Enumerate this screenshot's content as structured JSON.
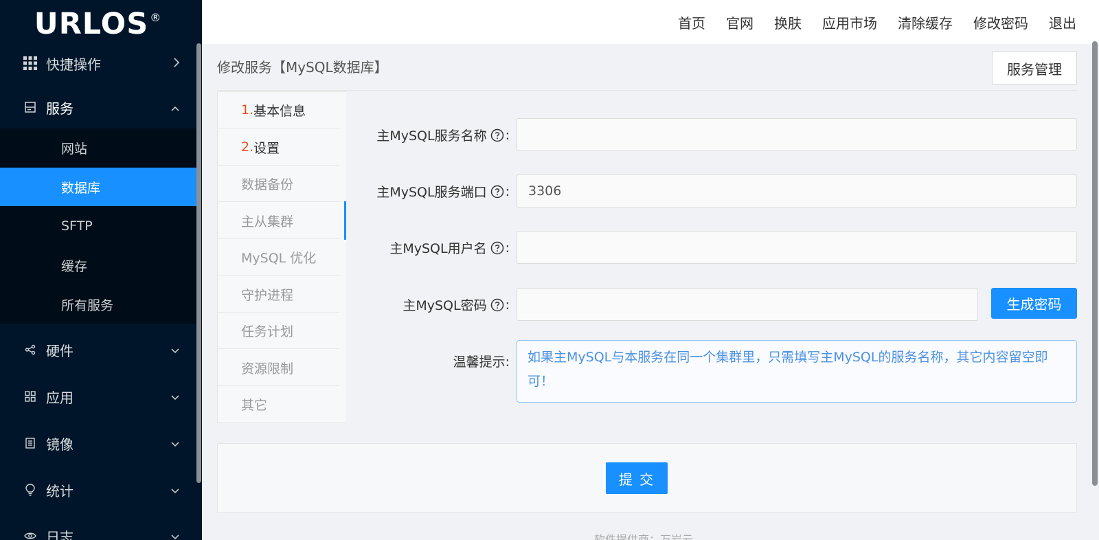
{
  "brand": {
    "name": "URLOS",
    "reg": "®"
  },
  "sidebar": {
    "menus": [
      {
        "label": "快捷操作",
        "icon": "grid-icon",
        "arrow": "right"
      },
      {
        "label": "服务",
        "icon": "server-icon",
        "arrow": "up"
      },
      {
        "label": "硬件",
        "icon": "share-icon",
        "arrow": "down"
      },
      {
        "label": "应用",
        "icon": "apps-icon",
        "arrow": "down"
      },
      {
        "label": "镜像",
        "icon": "image-icon",
        "arrow": "down"
      },
      {
        "label": "统计",
        "icon": "bulb-icon",
        "arrow": "down"
      },
      {
        "label": "日志",
        "icon": "eye-icon",
        "arrow": "down"
      }
    ],
    "service_items": [
      {
        "label": "网站"
      },
      {
        "label": "数据库",
        "active": true
      },
      {
        "label": "SFTP"
      },
      {
        "label": "缓存"
      },
      {
        "label": "所有服务"
      }
    ]
  },
  "topnav": [
    "首页",
    "官网",
    "换肤",
    "应用市场",
    "清除缓存",
    "修改密码",
    "退出"
  ],
  "page": {
    "title": "修改服务【MySQL数据库】",
    "manage_button": "服务管理"
  },
  "tabs": [
    {
      "num": "1.",
      "label": "基本信息"
    },
    {
      "num": "2.",
      "label": "设置"
    },
    {
      "label": "数据备份"
    },
    {
      "label": "主从集群"
    },
    {
      "label": "MySQL 优化"
    },
    {
      "label": "守护进程"
    },
    {
      "label": "任务计划"
    },
    {
      "label": "资源限制"
    },
    {
      "label": "其它"
    }
  ],
  "form": {
    "service_name": {
      "label": "主MySQL服务名称",
      "value": ""
    },
    "service_port": {
      "label": "主MySQL服务端口",
      "value": "3306"
    },
    "username": {
      "label": "主MySQL用户名",
      "value": ""
    },
    "password": {
      "label": "主MySQL密码",
      "value": ""
    },
    "colon": ":",
    "generate_button": "生成密码",
    "tip_label": "温馨提示:",
    "tip_text": "如果主MySQL与本服务在同一个集群里，只需填写主MySQL的服务名称，其它内容留空即可！"
  },
  "submit_label": "提 交",
  "footer": "软件提供商：万岩云",
  "colors": {
    "sidebar_bg": "#001529",
    "accent": "#1890ff",
    "step_num": "#e8501e"
  }
}
